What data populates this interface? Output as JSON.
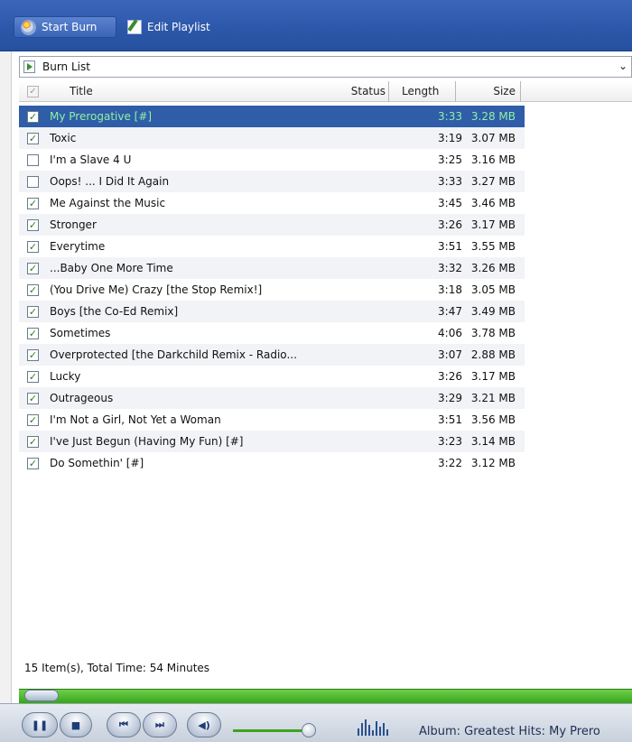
{
  "toolbar": {
    "start_burn_label": "Start Burn",
    "edit_playlist_label": "Edit Playlist"
  },
  "list_selector": {
    "label": "Burn List"
  },
  "columns": {
    "title": "Title",
    "status": "Status",
    "length": "Length",
    "size": "Size"
  },
  "tracks": [
    {
      "checked": true,
      "title": "My Prerogative [#]",
      "length": "3:33",
      "size": "3.28 MB",
      "selected": true
    },
    {
      "checked": true,
      "title": "Toxic",
      "length": "3:19",
      "size": "3.07 MB"
    },
    {
      "checked": false,
      "title": "I'm a Slave 4 U",
      "length": "3:25",
      "size": "3.16 MB"
    },
    {
      "checked": false,
      "title": "Oops! ... I Did It Again",
      "length": "3:33",
      "size": "3.27 MB"
    },
    {
      "checked": true,
      "title": "Me Against the Music",
      "length": "3:45",
      "size": "3.46 MB"
    },
    {
      "checked": true,
      "title": "Stronger",
      "length": "3:26",
      "size": "3.17 MB"
    },
    {
      "checked": true,
      "title": "Everytime",
      "length": "3:51",
      "size": "3.55 MB"
    },
    {
      "checked": true,
      "title": "...Baby One More Time",
      "length": "3:32",
      "size": "3.26 MB"
    },
    {
      "checked": true,
      "title": "(You Drive Me) Crazy [the Stop Remix!]",
      "length": "3:18",
      "size": "3.05 MB"
    },
    {
      "checked": true,
      "title": "Boys [the Co-Ed Remix]",
      "length": "3:47",
      "size": "3.49 MB"
    },
    {
      "checked": true,
      "title": "Sometimes",
      "length": "4:06",
      "size": "3.78 MB"
    },
    {
      "checked": true,
      "title": "Overprotected [the Darkchild Remix - Radio...",
      "length": "3:07",
      "size": "2.88 MB"
    },
    {
      "checked": true,
      "title": "Lucky",
      "length": "3:26",
      "size": "3.17 MB"
    },
    {
      "checked": true,
      "title": "Outrageous",
      "length": "3:29",
      "size": "3.21 MB"
    },
    {
      "checked": true,
      "title": "I'm Not a Girl, Not Yet a Woman",
      "length": "3:51",
      "size": "3.56 MB"
    },
    {
      "checked": true,
      "title": "I've Just Begun (Having My Fun) [#]",
      "length": "3:23",
      "size": "3.14 MB"
    },
    {
      "checked": true,
      "title": "Do Somethin' [#]",
      "length": "3:22",
      "size": "3.12 MB"
    }
  ],
  "summary": "15 Item(s), Total Time: 54 Minutes",
  "player": {
    "now_playing": "Album: Greatest Hits: My Prero"
  },
  "icons": {
    "start_burn": "burn-disc-icon",
    "edit_playlist": "edit-playlist-icon",
    "list": "playlist-icon",
    "dropdown": "chevron-down-icon"
  },
  "colors": {
    "toolbar_blue": "#2c56a8",
    "selected_row": "#2f5da8",
    "selected_text": "#8ff0a4",
    "seek_green": "#37a61b",
    "check_green": "#2f7e21"
  }
}
